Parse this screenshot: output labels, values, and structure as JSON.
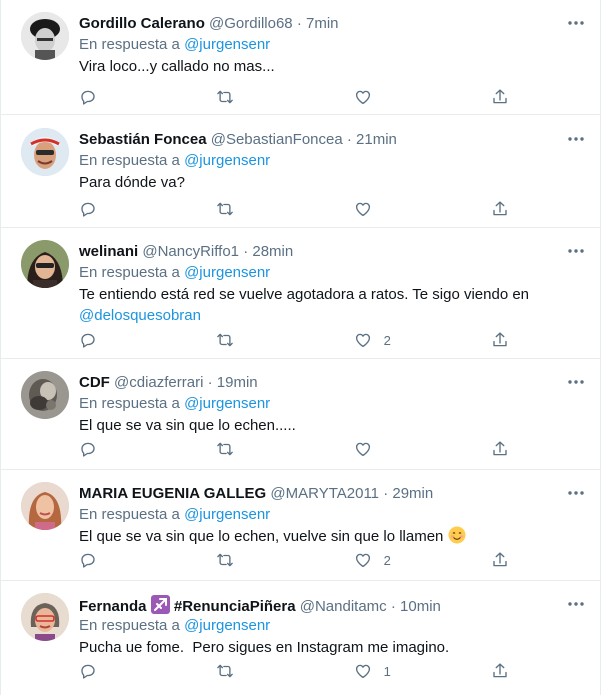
{
  "tweets": [
    {
      "name": "Gordillo Calerano",
      "handle": "@Gordillo68",
      "separator": "·",
      "time": "7min",
      "reply_prefix": "En respuesta a",
      "reply_mention": "@jurgensenr",
      "text": "Vira loco...y callado no mas...",
      "likes": ""
    },
    {
      "name": "Sebastián Foncea",
      "handle": "@SebastianFoncea",
      "separator": "·",
      "time": "21min",
      "reply_prefix": "En respuesta a",
      "reply_mention": "@jurgensenr",
      "text": "Para dónde va?",
      "likes": ""
    },
    {
      "name": "welinani",
      "handle": "@NancyRiffo1",
      "separator": "·",
      "time": "28min",
      "reply_prefix": "En respuesta a",
      "reply_mention": "@jurgensenr",
      "text": "Te entiendo está red se vuelve agotadora a ratos. Te sigo viendo en",
      "text_mention": "@delosquesobran",
      "likes": "2"
    },
    {
      "name": "CDF",
      "handle": "@cdiazferrari",
      "separator": "·",
      "time": "19min",
      "reply_prefix": "En respuesta a",
      "reply_mention": "@jurgensenr",
      "text": "El que se va sin que lo echen.....",
      "likes": ""
    },
    {
      "name": "MARIA EUGENIA GALLEG",
      "handle": "@MARYTA2011",
      "separator": "·",
      "time": "29min",
      "reply_prefix": "En respuesta a",
      "reply_mention": "@jurgensenr",
      "text": "El que se va sin que lo echen, vuelve sin que lo llamen",
      "emoji": "smiling-face-emoji",
      "likes": "2"
    },
    {
      "name": "Fernanda",
      "name_emoji": "sagittarius-emoji",
      "name_hashtag": "#RenunciaPiñera",
      "handle": "@Nanditamc",
      "separator": "·",
      "time": "10min",
      "reply_prefix": "En respuesta a",
      "reply_mention": "@jurgensenr",
      "text": "Pucha ue fome.  Pero sigues en Instagram me imagino.",
      "likes": "1"
    }
  ],
  "icons": {
    "reply": "reply-icon",
    "retweet": "retweet-icon",
    "like": "heart-icon",
    "share": "share-icon",
    "more": "more-icon"
  },
  "colors": {
    "mention": "#1b95e0",
    "muted": "#5b7083",
    "text": "#0f1419",
    "border": "#e6ecf0"
  }
}
